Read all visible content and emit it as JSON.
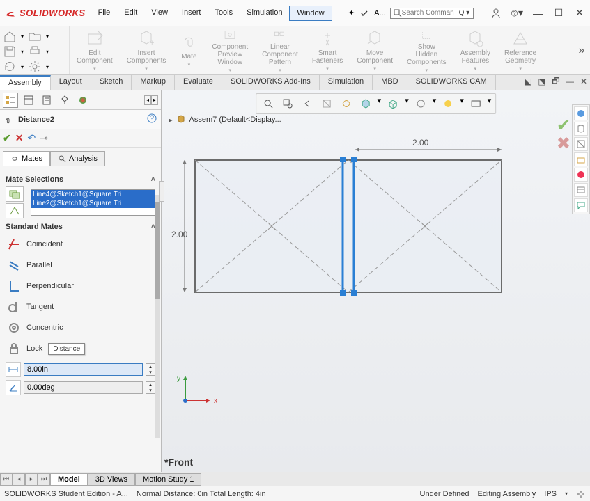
{
  "app": {
    "brand": "SOLIDWORKS",
    "quick_label": "A..."
  },
  "menus": [
    "File",
    "Edit",
    "View",
    "Insert",
    "Tools",
    "Simulation",
    "Window"
  ],
  "active_menu": "Window",
  "search": {
    "placeholder": "Search Comman"
  },
  "ribbon_items": [
    "Edit Component",
    "Insert Components",
    "Mate",
    "Component Preview Window",
    "Linear Component Pattern",
    "Smart Fasteners",
    "Move Component",
    "Show Hidden Components",
    "Assembly Features",
    "Reference Geometry"
  ],
  "tabs": [
    "Assembly",
    "Layout",
    "Sketch",
    "Markup",
    "Evaluate",
    "SOLIDWORKS Add-Ins",
    "Simulation",
    "MBD",
    "SOLIDWORKS CAM"
  ],
  "active_tab": "Assembly",
  "doc_title": "Assem7  (Default<Display...",
  "prop_title": "Distance2",
  "prop_tabs": {
    "mates": "Mates",
    "analysis": "Analysis"
  },
  "sections": {
    "mate_selections": "Mate Selections",
    "standard_mates": "Standard Mates"
  },
  "selections": [
    "Line4@Sketch1@Square Tri",
    "Line2@Sketch1@Square Tri"
  ],
  "standard_mates": [
    {
      "key": "coincident",
      "label": "Coincident"
    },
    {
      "key": "parallel",
      "label": "Parallel"
    },
    {
      "key": "perpendicular",
      "label": "Perpendicular"
    },
    {
      "key": "tangent",
      "label": "Tangent"
    },
    {
      "key": "concentric",
      "label": "Concentric"
    },
    {
      "key": "lock",
      "label": "Lock"
    }
  ],
  "tooltip": "Distance",
  "distance_value": "8.00in",
  "angle_value": "0.00deg",
  "dims": {
    "w": "2.00",
    "h": "2.00"
  },
  "triad": {
    "x": "x",
    "y": "y"
  },
  "view_label": "*Front",
  "bottom_tabs": [
    "Model",
    "3D Views",
    "Motion Study 1"
  ],
  "active_bottom_tab": "Model",
  "status": {
    "edition": "SOLIDWORKS Student Edition - A...",
    "info": "Normal Distance: 0in Total Length: 4in",
    "defined": "Under Defined",
    "mode": "Editing Assembly",
    "units": "IPS"
  }
}
